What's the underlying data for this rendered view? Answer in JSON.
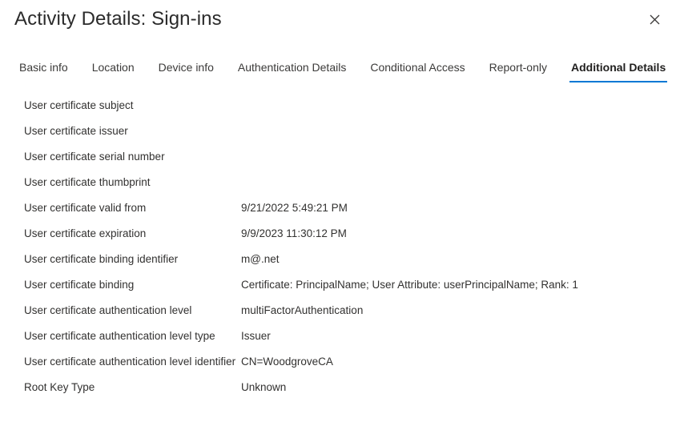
{
  "header": {
    "title": "Activity Details: Sign-ins",
    "close_label": "✕"
  },
  "tabs": [
    {
      "label": "Basic info",
      "active": false
    },
    {
      "label": "Location",
      "active": false
    },
    {
      "label": "Device info",
      "active": false
    },
    {
      "label": "Authentication Details",
      "active": false
    },
    {
      "label": "Conditional Access",
      "active": false
    },
    {
      "label": "Report-only",
      "active": false
    },
    {
      "label": "Additional Details",
      "active": true
    }
  ],
  "details": [
    {
      "label": "User certificate subject",
      "value": ""
    },
    {
      "label": "User certificate issuer",
      "value": ""
    },
    {
      "label": "User certificate serial number",
      "value": ""
    },
    {
      "label": "User certificate thumbprint",
      "value": ""
    },
    {
      "label": "User certificate valid from",
      "value": "9/21/2022 5:49:21 PM"
    },
    {
      "label": "User certificate expiration",
      "value": "9/9/2023 11:30:12 PM"
    },
    {
      "label": "User certificate binding identifier",
      "value": "m@.net"
    },
    {
      "label": "User certificate binding",
      "value": "Certificate: PrincipalName; User Attribute: userPrincipalName; Rank: 1"
    },
    {
      "label": "User certificate authentication level",
      "value": "multiFactorAuthentication"
    },
    {
      "label": "User certificate authentication level type",
      "value": "Issuer"
    },
    {
      "label": "User certificate authentication level identifier",
      "value": "CN=WoodgroveCA"
    },
    {
      "label": "Root Key Type",
      "value": "Unknown"
    }
  ],
  "colors": {
    "accent": "#0078d4",
    "text": "#323130",
    "title": "#2b2b2b",
    "background": "#ffffff"
  }
}
